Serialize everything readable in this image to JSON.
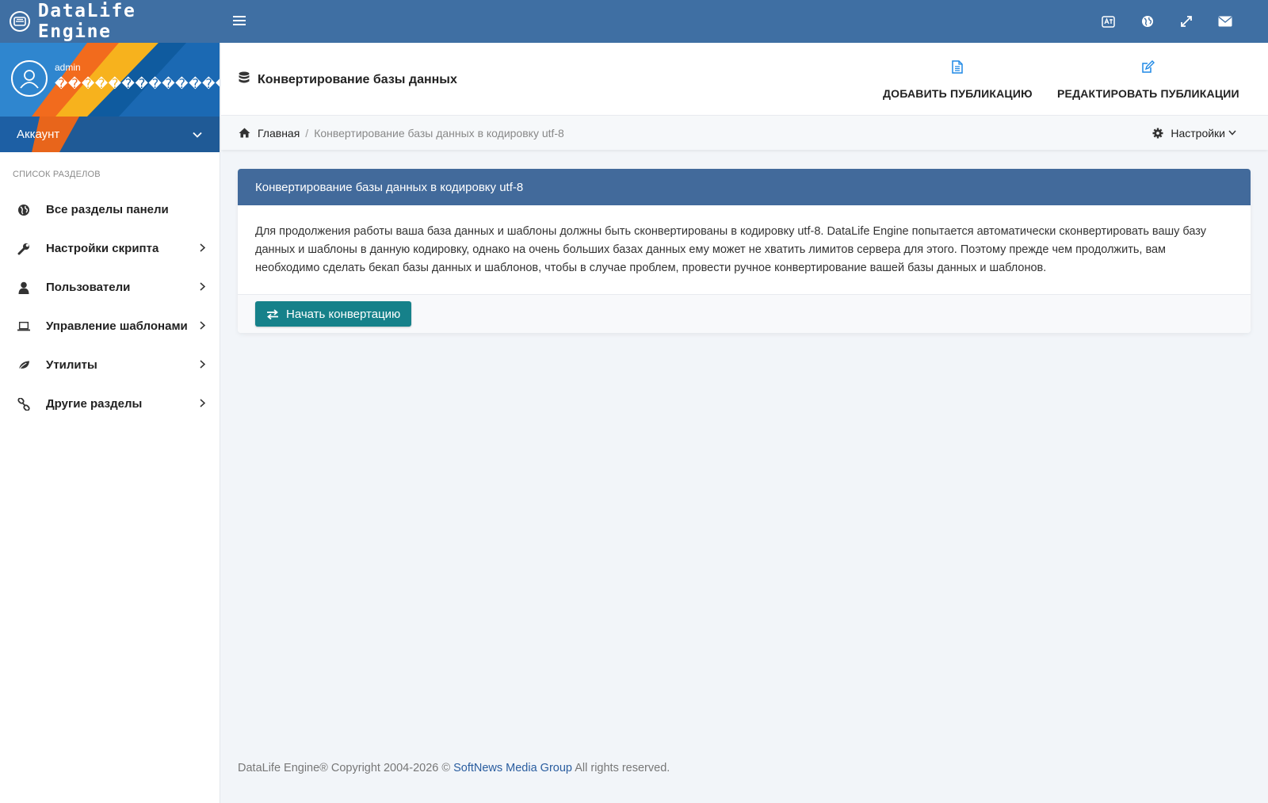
{
  "app": {
    "brand": "DataLife Engine"
  },
  "topbar": {
    "icons": [
      "translate-icon",
      "globe-icon",
      "expand-icon",
      "envelope-icon"
    ]
  },
  "sidebar": {
    "username": "admin",
    "role": "��������������",
    "account_label": "Аккаунт",
    "section_title": "СПИСОК РАЗДЕЛОВ",
    "items": [
      {
        "label": "Все разделы панели",
        "icon": "globe-icon",
        "has_children": false
      },
      {
        "label": "Настройки скрипта",
        "icon": "wrench-icon",
        "has_children": true
      },
      {
        "label": "Пользователи",
        "icon": "user-icon",
        "has_children": true
      },
      {
        "label": "Управление шаблонами",
        "icon": "laptop-icon",
        "has_children": true
      },
      {
        "label": "Утилиты",
        "icon": "leaf-icon",
        "has_children": true
      },
      {
        "label": "Другие разделы",
        "icon": "link-icon",
        "has_children": true
      }
    ]
  },
  "header": {
    "title": "Конвертирование базы данных",
    "actions": [
      {
        "label": "ДОБАВИТЬ ПУБЛИКАЦИЮ",
        "icon": "file-icon"
      },
      {
        "label": "РЕДАКТИРОВАТЬ ПУБЛИКАЦИИ",
        "icon": "edit-icon"
      }
    ]
  },
  "breadcrumb": {
    "home": "Главная",
    "separator": "/",
    "current": "Конвертирование базы данных в кодировку utf-8",
    "settings": "Настройки"
  },
  "card": {
    "title": "Конвертирование базы данных в кодировку utf-8",
    "body": "Для продолжения работы ваша база данных и шаблоны должны быть сконвертированы в кодировку utf-8. DataLife Engine попытается автоматически сконвертировать вашу базу данных и шаблоны в данную кодировку, однако на очень больших базах данных ему может не хватить лимитов сервера для этого. Поэтому прежде чем продолжить, вам необходимо сделать бекап базы данных и шаблонов, чтобы в случае проблем, провести ручное конвертирование вашей базы данных и шаблонов.",
    "button": "Начать конвертацию"
  },
  "footer": {
    "prefix": "DataLife Engine® Copyright 2004-2026 ©",
    "link": "SoftNews Media Group",
    "suffix": "All rights reserved."
  },
  "colors": {
    "topbar": "#3f6fa3",
    "card_header": "#426a9b",
    "button": "#16818a",
    "accent_icon": "#1e88e5"
  }
}
